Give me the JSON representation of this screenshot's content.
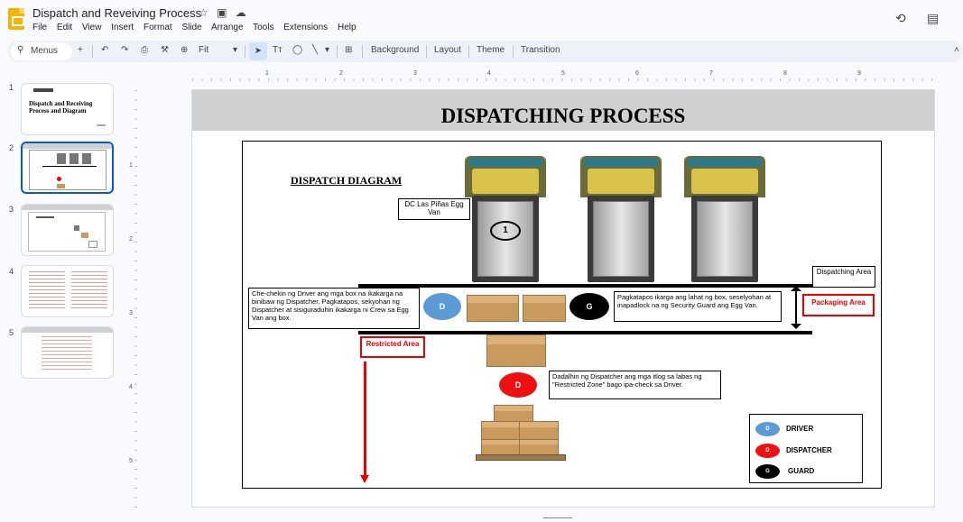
{
  "app": {
    "doc_title": "Dispatch and Reveiving Process",
    "menu": [
      "File",
      "Edit",
      "View",
      "Insert",
      "Format",
      "Slide",
      "Arrange",
      "Tools",
      "Extensions",
      "Help"
    ],
    "icons": [
      "star-icon",
      "folder-move-icon",
      "cloud-status-icon"
    ]
  },
  "toolbar": {
    "menus_label": "Menus",
    "zoom_label": "Fit",
    "background_label": "Background",
    "layout_label": "Layout",
    "theme_label": "Theme",
    "transition_label": "Transition"
  },
  "ruler": {
    "h_numbers": [
      "1",
      "2",
      "3",
      "4",
      "5",
      "6",
      "7",
      "8",
      "9"
    ],
    "v_numbers": [
      "1",
      "2",
      "3",
      "4",
      "5"
    ]
  },
  "filmstrip": {
    "slides": [
      {
        "num": "1",
        "title": "Dispatch and Receiving Process and Diagram"
      },
      {
        "num": "2",
        "title": ""
      },
      {
        "num": "3",
        "title": ""
      },
      {
        "num": "4",
        "title": ""
      },
      {
        "num": "5",
        "title": ""
      }
    ],
    "selected": 2
  },
  "slide": {
    "heading": "DISPATCHING PROCESS",
    "diagram_title": "DISPATCH DIAGRAM",
    "van_label": "DC Las Piñas Egg Van",
    "van_number": "1",
    "dispatching_area": "Dispatching Area",
    "packaging_area": "Packaging Area",
    "restricted_area": "Restricted Area",
    "left_text": {
      "p1": "Che-",
      "p2": "chekin",
      "p3": " ng ",
      "p4": "Driver",
      "p5": " ang ",
      "p6": "mga",
      "p7": " box ",
      "p8": "na",
      "full": "Che-chekin ng Driver ang mga box na ikakarga na binibaw ng Dispatcher. Pagkatapos, sekyohan ng Dispatcher at sisiguraduhin ikakarga ni Crew sa Egg Van ang box."
    },
    "right_text": "Pagkatapos ikarga ang lahat ng box, seselyohan at inapadlock na ng Security Guard ang Egg Van.",
    "bottom_text": "Dadalhin ng Dispatcher ang mga itlog sa labas ng \"Restricted Zone\" bago ipa-check sa Driver.",
    "circle_d": "D",
    "circle_g": "G",
    "legend": [
      {
        "abbr": "D",
        "label": "DRIVER",
        "color": "#5b9bd5"
      },
      {
        "abbr": "D",
        "label": "DISPATCHER",
        "color": "#ee1111"
      },
      {
        "abbr": "G",
        "label": "GUARD",
        "color": "#000000"
      }
    ]
  }
}
